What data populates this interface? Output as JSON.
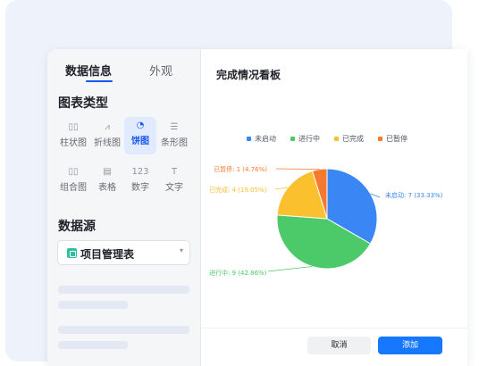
{
  "sidebar": {
    "tabs": [
      {
        "label": "数据信息",
        "active": true
      },
      {
        "label": "外观",
        "active": false
      }
    ],
    "chart_type_title": "图表类型",
    "chart_types": [
      {
        "label": "柱状图",
        "icon": "bar-chart-icon",
        "glyph": "▯▯",
        "selected": false
      },
      {
        "label": "折线图",
        "icon": "line-chart-icon",
        "glyph": "⩘",
        "selected": false
      },
      {
        "label": "饼图",
        "icon": "pie-chart-icon",
        "glyph": "◔",
        "selected": true
      },
      {
        "label": "条形图",
        "icon": "horizontal-bar-icon",
        "glyph": "☰",
        "selected": false
      },
      {
        "label": "组合图",
        "icon": "combo-chart-icon",
        "glyph": "▯▯",
        "selected": false
      },
      {
        "label": "表格",
        "icon": "table-icon",
        "glyph": "▤",
        "selected": false
      },
      {
        "label": "数字",
        "icon": "number-icon",
        "glyph": "123",
        "selected": false
      },
      {
        "label": "文字",
        "icon": "text-icon",
        "glyph": "T",
        "selected": false
      }
    ],
    "data_source_title": "数据源",
    "data_source": {
      "value": "项目管理表",
      "icon": "table-icon"
    }
  },
  "main": {
    "title": "完成情况看板",
    "cancel_label": "取消",
    "add_label": "添加"
  },
  "colors": {
    "accent": "#1677ff",
    "series": [
      "#3b86f5",
      "#4cc968",
      "#fbc02d",
      "#f57a2f"
    ]
  },
  "chart_data": {
    "type": "pie",
    "title": "",
    "legend_position": "top",
    "slices": [
      {
        "name": "未启动",
        "value": 7,
        "percent": "33.33%",
        "label": "未启动: 7 (33.33%)"
      },
      {
        "name": "进行中",
        "value": 9,
        "percent": "42.86%",
        "label": "进行中: 9 (42.86%)"
      },
      {
        "name": "已完成",
        "value": 4,
        "percent": "19.05%",
        "label": "已完成: 4 (19.05%)"
      },
      {
        "name": "已暂停",
        "value": 1,
        "percent": "4.76%",
        "label": "已暂停: 1 (4.76%)"
      }
    ]
  }
}
